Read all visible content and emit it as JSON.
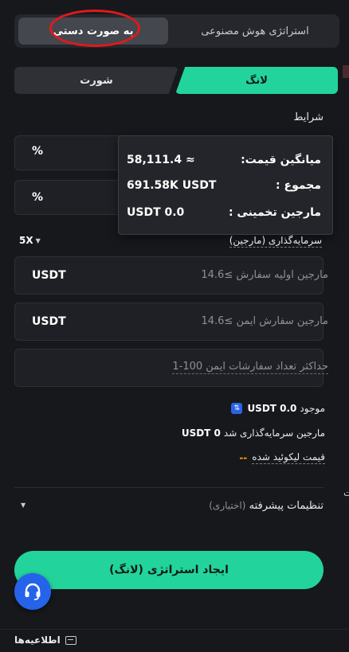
{
  "mode_tabs": {
    "manual": "به صورت دستی",
    "ai": "استراتژی هوش مصنوعی"
  },
  "direction": {
    "long": "لانگ",
    "short": "شورت"
  },
  "conditions": {
    "label": "شرایط",
    "field1_unit": "%",
    "field2_unit": "%"
  },
  "tooltip": {
    "avg_price_label": "میانگین قیمت:",
    "avg_price_value": "58,111.4 ≈",
    "total_label": "مجموع   :",
    "total_value": "691.58K USDT",
    "est_margin_label": "مارجین تخمینی   :",
    "est_margin_value": "USDT 0.0"
  },
  "investment": {
    "leverage": "5X",
    "label": "سرمایه‌گذاری (مارجین)",
    "initial_order_placeholder": "مارجین اولیه سفارش  ≥14.6",
    "initial_order_unit": "USDT",
    "safety_order_placeholder": "مارجین سفارش ایمن  ≥14.6",
    "safety_order_unit": "USDT",
    "max_safety_placeholder": "حداکثر تعداد سفارشات ایمن  100-1"
  },
  "balance": {
    "available_label": "موجود",
    "available_value": "USDT 0.0",
    "invested_label": "مارجین سرمایه‌گذاری شد",
    "invested_value": "USDT 0",
    "liq_label": "قیمت لیکوئید شده",
    "liq_value": "--"
  },
  "advanced": {
    "label": "تنظیمات پیشرفته",
    "optional": "(اختیاری)"
  },
  "create_button": "ایجاد استراتژی (لانگ)",
  "footer": {
    "notifications": "اطلاعیه‌ها"
  },
  "colors": {
    "accent_green": "#22d49b",
    "annotation_red": "#e0191d",
    "support_blue": "#2563eb",
    "liq_orange": "#f6a609"
  },
  "icons": [
    "swap-icon",
    "headset-icon",
    "notification-icon",
    "caret-down-icon"
  ]
}
